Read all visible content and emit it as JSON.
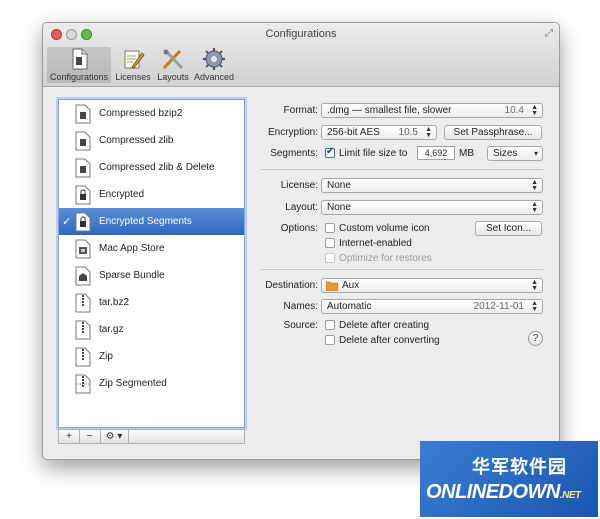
{
  "window": {
    "title": "Configurations"
  },
  "toolbar": {
    "items": [
      {
        "label": "Configurations",
        "icon": "document-icon",
        "selected": true
      },
      {
        "label": "Licenses",
        "icon": "license-pen-icon",
        "selected": false
      },
      {
        "label": "Layouts",
        "icon": "layout-tools-icon",
        "selected": false
      },
      {
        "label": "Advanced",
        "icon": "gear-icon",
        "selected": false
      }
    ]
  },
  "configs": {
    "items": [
      {
        "name": "Compressed bzip2"
      },
      {
        "name": "Compressed zlib"
      },
      {
        "name": "Compressed zlib & Delete"
      },
      {
        "name": "Encrypted"
      },
      {
        "name": "Encrypted Segments",
        "selected": true,
        "check": "✓"
      },
      {
        "name": "Mac App Store"
      },
      {
        "name": "Sparse Bundle"
      },
      {
        "name": "tar.bz2"
      },
      {
        "name": "tar.gz"
      },
      {
        "name": "Zip"
      },
      {
        "name": "Zip Segmented"
      }
    ],
    "bar": {
      "add": "+",
      "remove": "−",
      "action": "⚙ ▾"
    }
  },
  "settings": {
    "format": {
      "label": "Format:",
      "value": ".dmg — smallest file, slower",
      "version": "10.4"
    },
    "encryption": {
      "label": "Encryption:",
      "value": "256-bit AES",
      "version": "10.5",
      "button": "Set Passphrase..."
    },
    "segments": {
      "label": "Segments:",
      "checkbox_label": "Limit file size to",
      "checked": true,
      "size": "4,692",
      "unit": "MB",
      "popup": "Sizes"
    },
    "license": {
      "label": "License:",
      "value": "None"
    },
    "layout": {
      "label": "Layout:",
      "value": "None"
    },
    "options": {
      "label": "Options:",
      "custom_icon": "Custom volume icon",
      "set_icon_button": "Set Icon...",
      "internet_enabled": "Internet-enabled",
      "optimize": "Optimize for restores"
    },
    "destination": {
      "label": "Destination:",
      "value": "Aux"
    },
    "names": {
      "label": "Names:",
      "value": "Automatic",
      "date": "2012-11-01"
    },
    "source": {
      "label": "Source:",
      "delete_creating": "Delete after creating",
      "delete_converting": "Delete after converting"
    },
    "help": "?"
  },
  "watermark": {
    "cn": "华军软件园",
    "en": "ONLINEDOWN",
    "net": ".NET"
  },
  "colors": {
    "selection": "#2f67c0",
    "list_border": "#7fa4d6",
    "close": "#ee5a50",
    "zoom": "#5fc04b"
  }
}
